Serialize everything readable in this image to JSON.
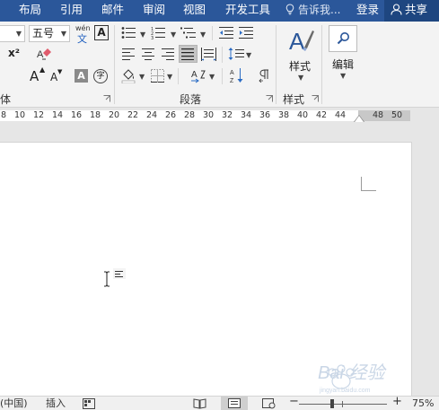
{
  "tabs": [
    "布局",
    "引用",
    "邮件",
    "审阅",
    "视图",
    "开发工具"
  ],
  "tell_me": "告诉我...",
  "login": "登录",
  "share": "共享",
  "font_size": "五号",
  "pinyin_label": "wén",
  "pinyin_char": "文",
  "charborder_char": "A",
  "superscript": "x²",
  "grow_font": "A",
  "shrink_font": "A",
  "shade_char": "A",
  "encircle_char": "字",
  "groups": {
    "font_partial": "体",
    "paragraph": "段落",
    "styles": "样式"
  },
  "styles_button": "样式",
  "editing_button": "编辑",
  "ruler_ticks": [
    "8",
    "10",
    "12",
    "14",
    "16",
    "18",
    "20",
    "22",
    "24",
    "26",
    "28",
    "30",
    "32",
    "34",
    "36",
    "38",
    "40",
    "42",
    "44",
    "48",
    "50"
  ],
  "status": {
    "language": "(中国)",
    "insert_mode": "插入",
    "zoom_minus": "−",
    "zoom_plus": "+",
    "zoom_level": "75%"
  },
  "watermark": "Bai 经验",
  "accent_color": "#2b579a",
  "icons": [
    "lightbulb-icon",
    "person-icon",
    "bullets-icon",
    "numbering-icon",
    "multilevel-list-icon",
    "decrease-indent-icon",
    "increase-indent-icon",
    "align-left-icon",
    "align-center-icon",
    "align-right-icon",
    "justify-icon",
    "distributed-icon",
    "line-spacing-icon",
    "shading-icon",
    "borders-icon",
    "text-direction-icon",
    "sort-icon",
    "paragraph-mark-icon",
    "styles-icon",
    "find-icon",
    "text-cursor-icon"
  ]
}
